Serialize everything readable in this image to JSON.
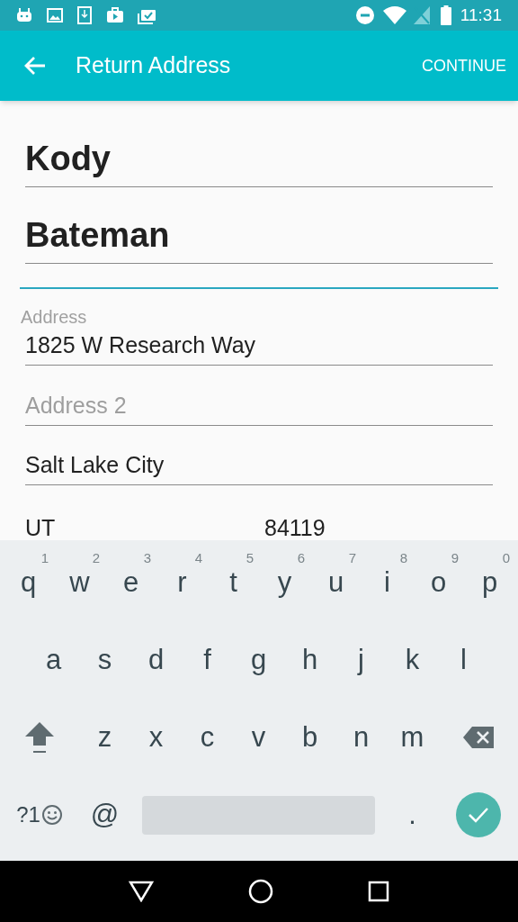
{
  "status_bar": {
    "time": "11:31"
  },
  "app_bar": {
    "title": "Return Address",
    "action": "CONTINUE"
  },
  "form": {
    "first_name": "Kody",
    "last_name": "Bateman",
    "address_label": "Address",
    "address": "1825 W Research Way",
    "address2_placeholder": "Address 2",
    "city": "Salt Lake City",
    "state": "UT",
    "zip": "84119"
  },
  "keyboard": {
    "top_row": [
      {
        "kind": "letter",
        "label": "q",
        "hint": "1"
      },
      {
        "kind": "letter",
        "label": "w",
        "hint": "2"
      },
      {
        "kind": "letter",
        "label": "e",
        "hint": "3"
      },
      {
        "kind": "letter",
        "label": "r",
        "hint": "4"
      },
      {
        "kind": "letter",
        "label": "t",
        "hint": "5"
      },
      {
        "kind": "letter",
        "label": "y",
        "hint": "6"
      },
      {
        "kind": "letter",
        "label": "u",
        "hint": "7"
      },
      {
        "kind": "letter",
        "label": "i",
        "hint": "8"
      },
      {
        "kind": "letter",
        "label": "o",
        "hint": "9"
      },
      {
        "kind": "letter",
        "label": "p",
        "hint": "0"
      }
    ],
    "home_row": [
      {
        "kind": "letter",
        "label": "a"
      },
      {
        "kind": "letter",
        "label": "s"
      },
      {
        "kind": "letter",
        "label": "d"
      },
      {
        "kind": "letter",
        "label": "f"
      },
      {
        "kind": "letter",
        "label": "g"
      },
      {
        "kind": "letter",
        "label": "h"
      },
      {
        "kind": "letter",
        "label": "j"
      },
      {
        "kind": "letter",
        "label": "k"
      },
      {
        "kind": "letter",
        "label": "l"
      }
    ],
    "bottom_row": [
      {
        "kind": "shift"
      },
      {
        "kind": "letter",
        "label": "z"
      },
      {
        "kind": "letter",
        "label": "x"
      },
      {
        "kind": "letter",
        "label": "c"
      },
      {
        "kind": "letter",
        "label": "v"
      },
      {
        "kind": "letter",
        "label": "b"
      },
      {
        "kind": "letter",
        "label": "n"
      },
      {
        "kind": "letter",
        "label": "m"
      },
      {
        "kind": "backspace"
      }
    ],
    "function_row": [
      {
        "kind": "symbols",
        "label": "?1"
      },
      {
        "kind": "letter",
        "label": "@"
      },
      {
        "kind": "space"
      },
      {
        "kind": "letter",
        "label": "."
      },
      {
        "kind": "enter"
      }
    ]
  }
}
